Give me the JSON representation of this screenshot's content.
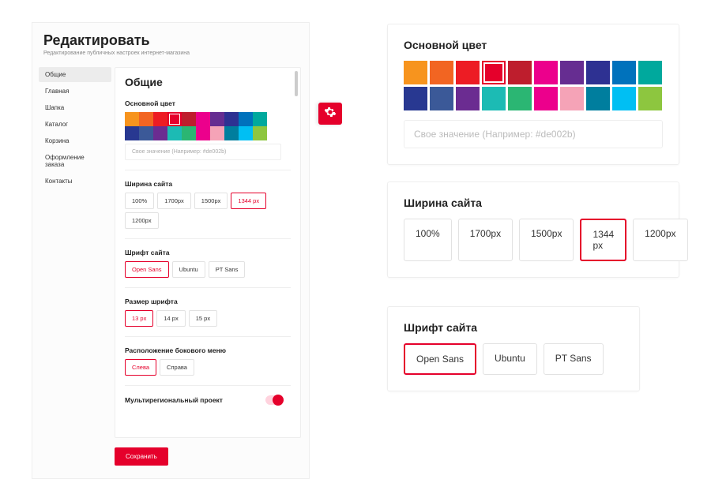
{
  "left": {
    "title": "Редактировать",
    "subtitle": "Редактирование публичных настроек интернет-магазина",
    "tabs": [
      "Общие",
      "Главная",
      "Шапка",
      "Каталог",
      "Корзина",
      "Оформление заказа",
      "Контакты"
    ],
    "active_tab": 0,
    "section_title": "Общие",
    "color_label": "Основной цвет",
    "color_placeholder": "Свое значение (Например: #de002b)",
    "width_label": "Ширина сайта",
    "width_options": [
      "100%",
      "1700px",
      "1500px",
      "1344 px",
      "1200px"
    ],
    "width_selected": 3,
    "font_label": "Шрифт сайта",
    "font_options": [
      "Open Sans",
      "Ubuntu",
      "PT Sans"
    ],
    "font_selected": 0,
    "fontsize_label": "Размер шрифта",
    "fontsize_options": [
      "13 px",
      "14 px",
      "15 px"
    ],
    "fontsize_selected": 0,
    "sidepos_label": "Расположение бокового меню",
    "sidepos_options": [
      "Слева",
      "Справа"
    ],
    "sidepos_selected": 0,
    "multiregion_label": "Мультирегиональный проект",
    "save_label": "Сохранить"
  },
  "colors": {
    "swatches": [
      "#f7941e",
      "#f26522",
      "#ed1c24",
      "#e5002b",
      "#be1e2d",
      "#ec008c",
      "#662d91",
      "#2e3192",
      "#0072bc",
      "#00a99d",
      "#283891",
      "#3b5998",
      "#6b2c91",
      "#1cbbb4",
      "#2bb673",
      "#ec008c",
      "#f5a3b7",
      "#007e9e",
      "#00bff3",
      "#8dc63f"
    ],
    "selected": 3
  },
  "right": {
    "color_title": "Основной цвет",
    "color_placeholder": "Свое значение (Например: #de002b)",
    "width_title": "Ширина сайта",
    "width_options": [
      "100%",
      "1700px",
      "1500px",
      "1344 px",
      "1200px"
    ],
    "width_selected": 3,
    "font_title": "Шрифт сайта",
    "font_options": [
      "Open Sans",
      "Ubuntu",
      "PT Sans"
    ],
    "font_selected": 0
  }
}
